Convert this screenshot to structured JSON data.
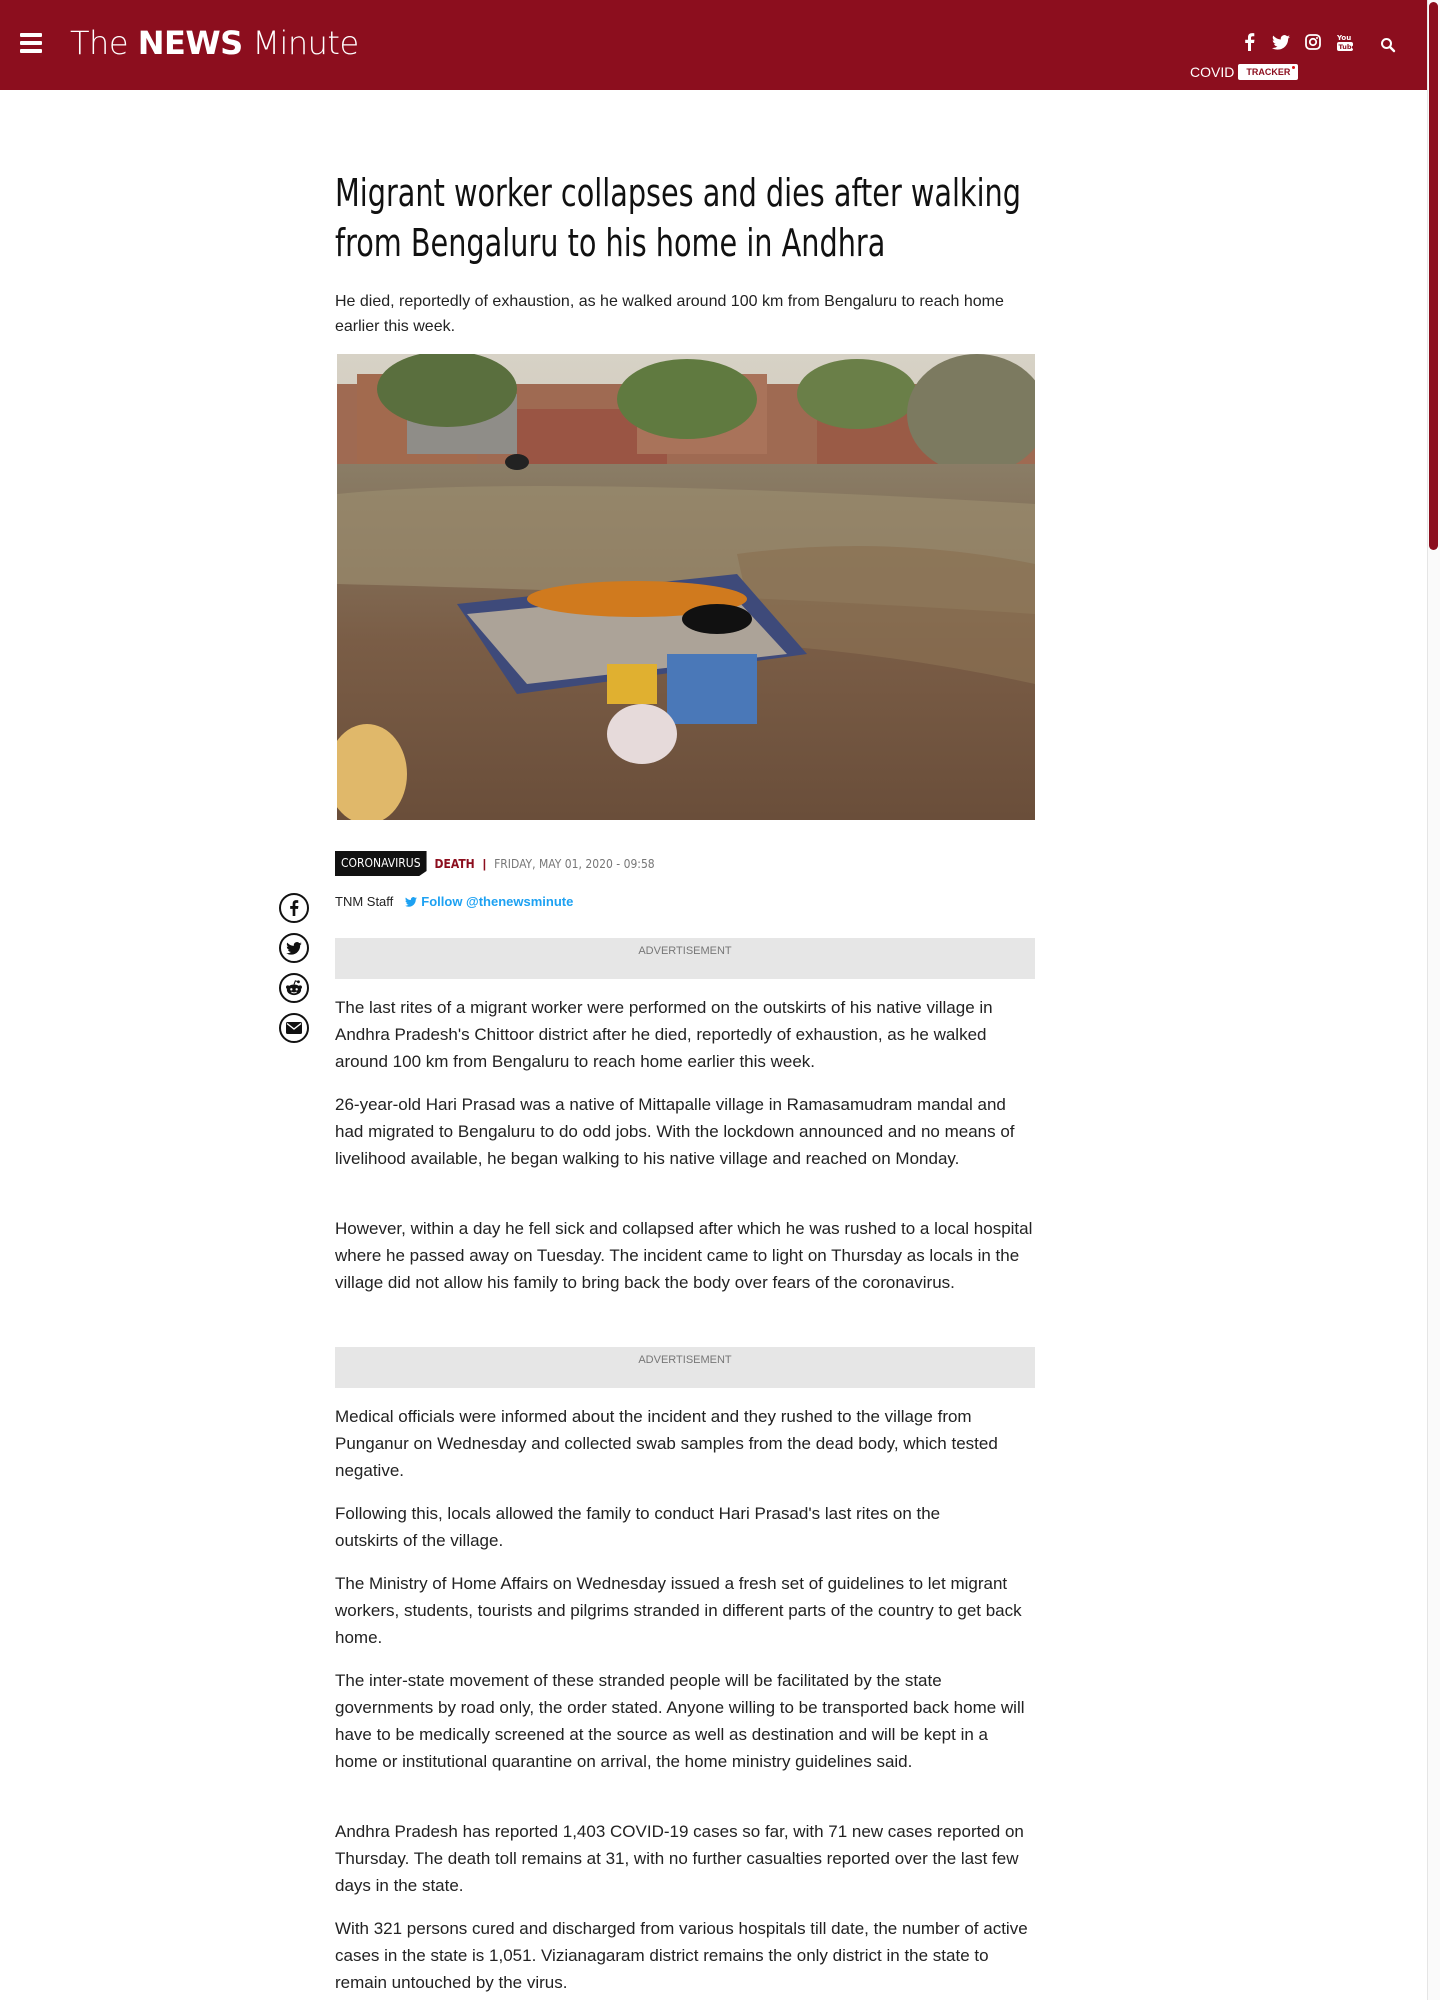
{
  "header": {
    "brand": {
      "part1": "The",
      "part2": "NEWS",
      "part3": "Minute"
    },
    "covid_label": "COVID",
    "tracker_label": "TRACKER",
    "social_icons": [
      "facebook-icon",
      "twitter-icon",
      "instagram-icon",
      "youtube-icon"
    ],
    "search_icon": "search-icon"
  },
  "article": {
    "title": "Migrant worker collapses and dies after walking from Bengaluru to his home in Andhra",
    "subtitle": "He died, reportedly of exhaustion, as he walked around 100 km from Bengaluru to reach home earlier this week.",
    "category": "CORONAVIRUS",
    "tag": "DEATH",
    "separator": "|",
    "date": "FRIDAY, MAY 01, 2020 - 09:58",
    "author": "TNM Staff",
    "follow_label": "Follow @thenewsminute",
    "ad_label_1": "ADVERTISEMENT",
    "ad_label_2": "ADVERTISEMENT",
    "paragraphs": [
      "The last rites of a migrant worker were performed on the outskirts of his native village in Andhra Pradesh's Chittoor district after he died, reportedly of exhaustion, as he walked around 100 km from Bengaluru to reach home earlier this week.",
      "26-year-old Hari Prasad was a native of Mittapalle village in Ramasamudram mandal and had migrated to Bengaluru to do odd jobs. With the lockdown announced and no means of livelihood available, he began walking to his native village and reached on Monday.",
      "However, within a day he fell sick and collapsed after which he was rushed to a local hospital where he passed away on Tuesday. The incident came to light on Thursday as locals in the village did not allow his family to bring back the body over fears of the coronavirus.",
      "Medical officials were informed about the incident and they rushed to the village from Punganur on Wednesday and collected swab samples from the dead body, which tested negative.",
      "Following this, locals allowed the family to conduct Hari Prasad's last rites on the outskirts of the village.",
      "The Ministry of Home Affairs on Wednesday issued a fresh set of guidelines to let migrant workers, students, tourists and pilgrims stranded in different parts of the country to get back home.",
      "The inter-state movement of these stranded people will be facilitated by the state governments by road only, the order stated. Anyone willing to be transported back home will have to be medically screened at the source as well as destination and will be kept in a home or institutional quarantine on arrival, the home ministry guidelines said.",
      "Andhra Pradesh has reported 1,403 COVID-19 cases so far, with 71 new cases reported on Thursday. The death toll remains at 31, with no further casualties reported over the last few days in the state.",
      "With 321 persons cured and discharged from various hospitals till date, the number of active cases in the state is 1,051. Vizianagaram district remains the only district in the state to remain untouched by the virus."
    ]
  },
  "share_icons": [
    "facebook-icon",
    "twitter-icon",
    "reddit-icon",
    "email-icon"
  ],
  "colors": {
    "brand": "#8c0e1e",
    "twitter": "#1da1f2",
    "ad_bg": "#e6e6e6"
  }
}
